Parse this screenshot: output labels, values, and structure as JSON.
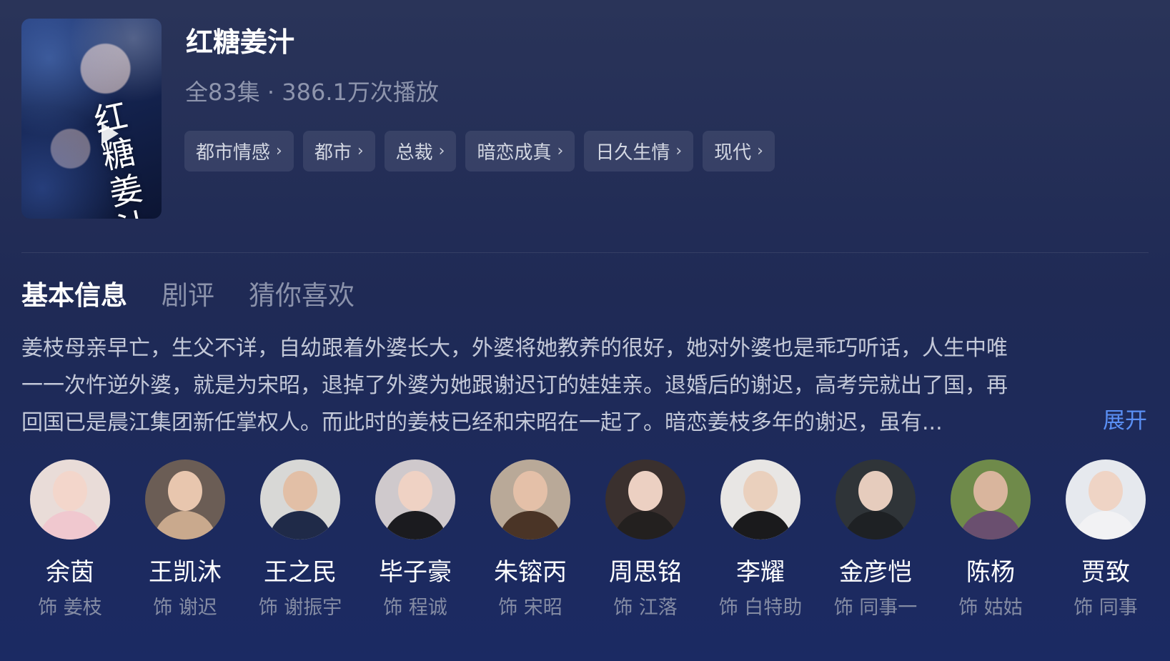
{
  "drama": {
    "title": "红糖姜汁",
    "poster_title": "红糖姜汁",
    "meta": "全83集 · 386.1万次播放",
    "tags": [
      "都市情感",
      "都市",
      "总裁",
      "暗恋成真",
      "日久生情",
      "现代"
    ]
  },
  "tabs": [
    {
      "label": "基本信息",
      "active": true
    },
    {
      "label": "剧评",
      "active": false
    },
    {
      "label": "猜你喜欢",
      "active": false
    }
  ],
  "synopsis": {
    "lines": [
      "姜枝母亲早亡，生父不详，自幼跟着外婆长大，外婆将她教养的很好，她对外婆也是乖巧听话，人生中唯",
      "一一次忤逆外婆，就是为宋昭，退掉了外婆为她跟谢迟订的娃娃亲。退婚后的谢迟，高考完就出了国，再",
      "回国已是晨江集团新任掌权人。而此时的姜枝已经和宋昭在一起了。暗恋姜枝多年的谢迟，虽有..."
    ],
    "expand_label": "展开",
    "expand_color": "#5a8ff4"
  },
  "cast": [
    {
      "name": "余茵",
      "role": "饰 姜枝",
      "bg": "#e9dcd8",
      "skin": "#f3d6cb",
      "cloth": "#f0c8cf"
    },
    {
      "name": "王凯沐",
      "role": "饰 谢迟",
      "bg": "#6b5d55",
      "skin": "#e8c6ae",
      "cloth": "#c9a98d"
    },
    {
      "name": "王之民",
      "role": "饰 谢振宇",
      "bg": "#d8d8d6",
      "skin": "#e2bfa6",
      "cloth": "#1f2a48"
    },
    {
      "name": "毕子豪",
      "role": "饰 程诚",
      "bg": "#cfc9cc",
      "skin": "#efd2c4",
      "cloth": "#1b1b1f"
    },
    {
      "name": "朱镕丙",
      "role": "饰 宋昭",
      "bg": "#b9a998",
      "skin": "#e4c0a8",
      "cloth": "#4a3426"
    },
    {
      "name": "周思铭",
      "role": "饰 江落",
      "bg": "#3a302e",
      "skin": "#ecd0c2",
      "cloth": "#23201f"
    },
    {
      "name": "李耀",
      "role": "饰 白特助",
      "bg": "#e8e6e4",
      "skin": "#ead0bd",
      "cloth": "#1a1a1c"
    },
    {
      "name": "金彦恺",
      "role": "饰 同事一",
      "bg": "#2f3438",
      "skin": "#e6ccbd",
      "cloth": "#1e2124"
    },
    {
      "name": "陈杨",
      "role": "饰 姑姑",
      "bg": "#6f8a4a",
      "skin": "#d9b59d",
      "cloth": "#6a4f6f"
    },
    {
      "name": "贾致",
      "role": "饰 同事",
      "bg": "#e6e9ee",
      "skin": "#efd4c5",
      "cloth": "#f2f2f4"
    }
  ]
}
